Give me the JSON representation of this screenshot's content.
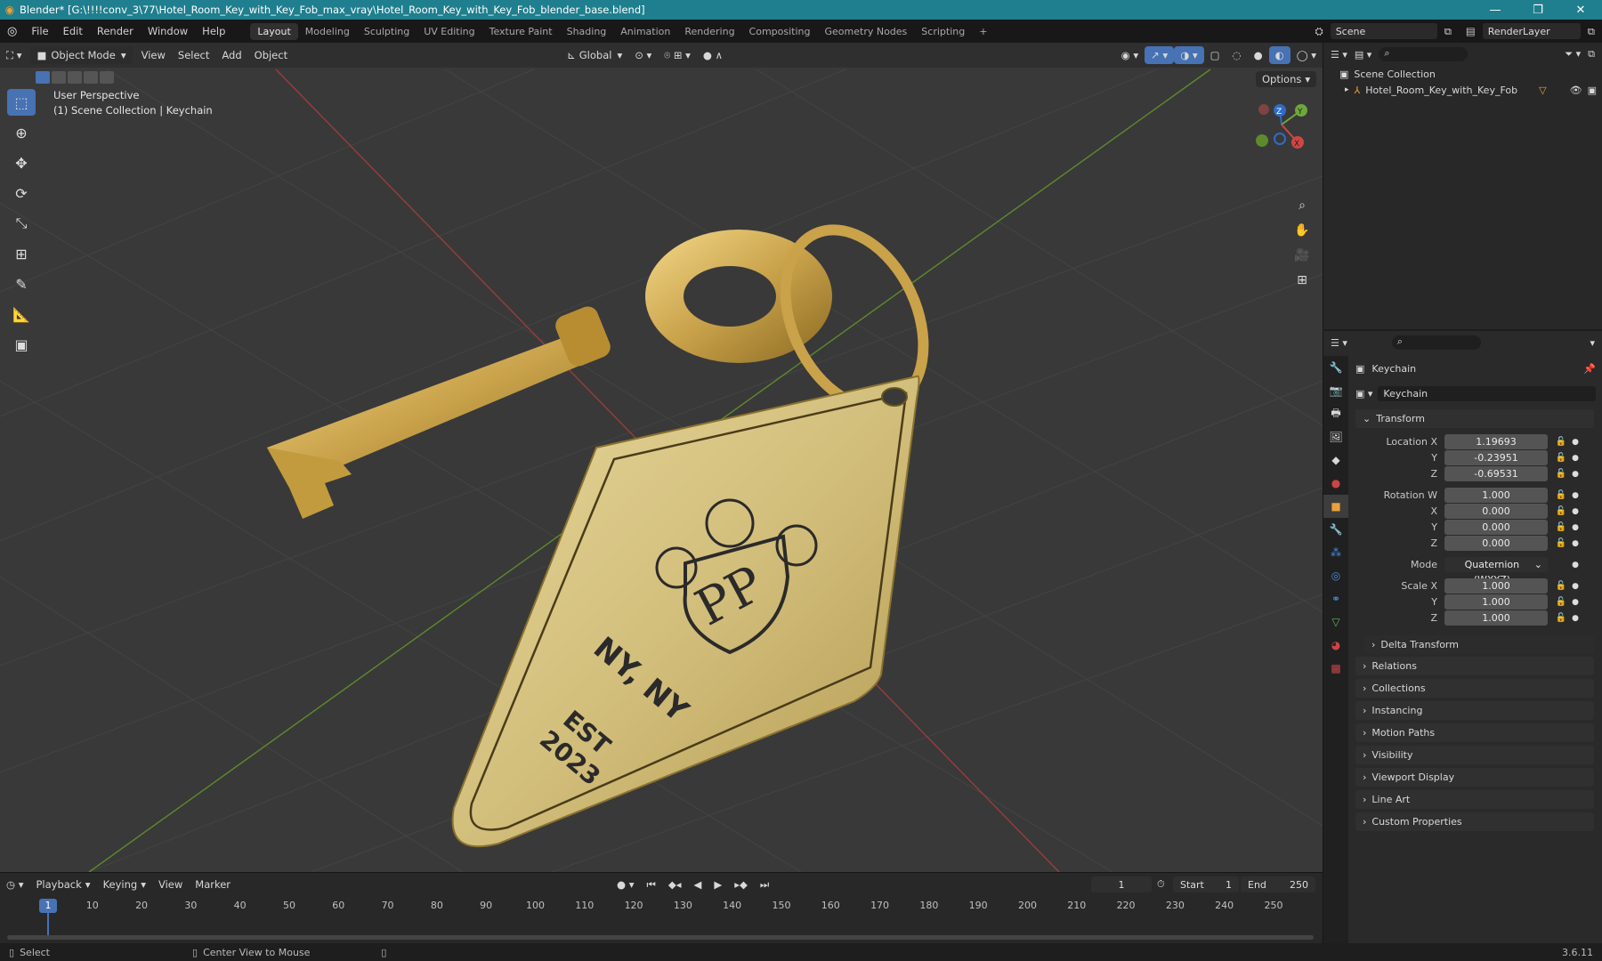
{
  "titlebar": {
    "title": "Blender* [G:\\!!!!conv_3\\77\\Hotel_Room_Key_with_Key_Fob_max_vray\\Hotel_Room_Key_with_Key_Fob_blender_base.blend]",
    "minimize": "—",
    "maximize": "❐",
    "close": "✕"
  },
  "menu": [
    "File",
    "Edit",
    "Render",
    "Window",
    "Help"
  ],
  "workspaces": [
    "Layout",
    "Modeling",
    "Sculpting",
    "UV Editing",
    "Texture Paint",
    "Shading",
    "Animation",
    "Rendering",
    "Compositing",
    "Geometry Nodes",
    "Scripting"
  ],
  "add_workspace": "+",
  "scene": {
    "name": "Scene",
    "view_layer": "RenderLayer"
  },
  "viewport": {
    "mode": "Object Mode",
    "menus": [
      "View",
      "Select",
      "Add",
      "Object"
    ],
    "orientation": "Global",
    "options": "Options",
    "info_line1": "User Perspective",
    "info_line2": "(1) Scene Collection | Keychain",
    "gizmo": {
      "x": "X",
      "y": "Y",
      "z": "Z"
    }
  },
  "fob_text": {
    "monogram": "PP",
    "city": "NY, NY",
    "est": "EST",
    "year": "2023"
  },
  "outliner": {
    "root": "Scene Collection",
    "item": "Hotel_Room_Key_with_Key_Fob"
  },
  "properties": {
    "object_name": "Keychain",
    "data_name": "Keychain",
    "transform_label": "Transform",
    "location": {
      "label": "Location X",
      "x": "1.19693",
      "y": "-0.23951",
      "z": "-0.69531"
    },
    "rotation": {
      "label": "Rotation W",
      "w": "1.000",
      "x": "0.000",
      "y": "0.000",
      "z": "0.000"
    },
    "mode_label": "Mode",
    "mode_value": "Quaternion (WXYZ)",
    "scale": {
      "label": "Scale X",
      "x": "1.000",
      "y": "1.000",
      "z": "1.000"
    },
    "axis_y": "Y",
    "axis_z": "Z",
    "axis_x": "X",
    "delta": "Delta Transform",
    "sections": [
      "Relations",
      "Collections",
      "Instancing",
      "Motion Paths",
      "Visibility",
      "Viewport Display",
      "Line Art",
      "Custom Properties"
    ]
  },
  "timeline": {
    "menus": [
      "Playback",
      "Keying",
      "View",
      "Marker"
    ],
    "current_frame": "1",
    "start_label": "Start",
    "start": "1",
    "end_label": "End",
    "end": "250",
    "ticks": [
      "1",
      "10",
      "20",
      "30",
      "40",
      "50",
      "60",
      "70",
      "80",
      "90",
      "100",
      "110",
      "120",
      "130",
      "140",
      "150",
      "160",
      "170",
      "180",
      "190",
      "200",
      "210",
      "220",
      "230",
      "240",
      "250"
    ]
  },
  "statusbar": {
    "select": "Select",
    "center": "Center View to Mouse",
    "version": "3.6.11"
  },
  "colors": {
    "accent": "#4772b3",
    "titlebar": "#1f7f8e",
    "gold": "#c9a24a"
  }
}
